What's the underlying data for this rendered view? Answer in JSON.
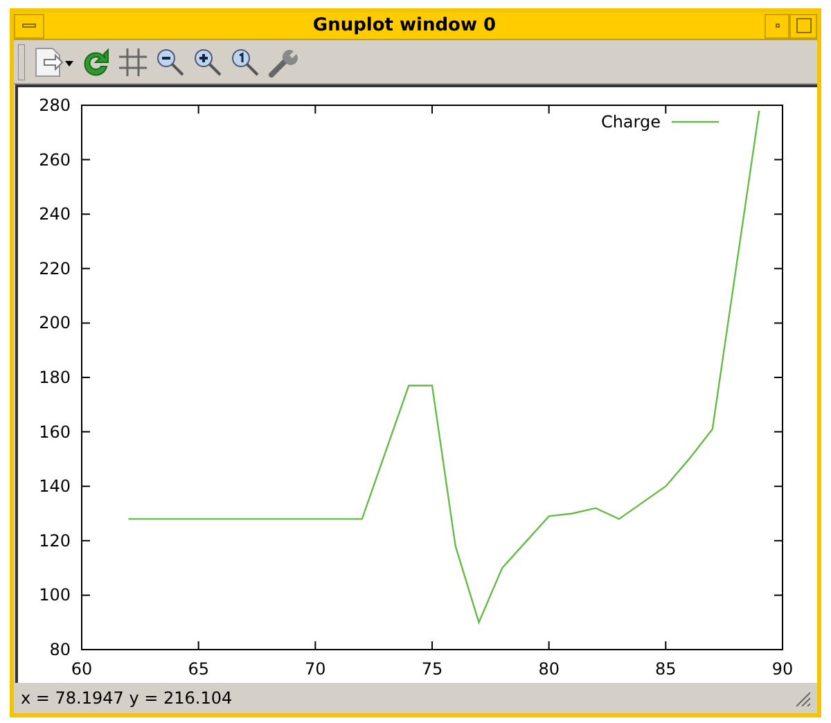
{
  "window": {
    "title": "Gnuplot window 0"
  },
  "plot": {
    "chart_data": {
      "type": "line",
      "x": [
        62,
        72,
        74,
        75,
        76,
        77,
        78,
        80,
        81,
        82,
        83,
        85,
        86,
        87,
        89
      ],
      "series": [
        {
          "name": "Charge",
          "color": "#66bb44",
          "values": [
            128,
            128,
            177,
            177,
            118,
            90,
            110,
            129,
            130,
            132,
            128,
            140,
            150,
            161,
            278
          ]
        }
      ],
      "xlim": [
        60,
        90
      ],
      "ylim": [
        80,
        280
      ],
      "xticks": [
        60,
        65,
        70,
        75,
        80,
        85,
        90
      ],
      "yticks": [
        80,
        100,
        120,
        140,
        160,
        180,
        200,
        220,
        240,
        260,
        280
      ]
    }
  },
  "status_bar": "x = 78.1947 y = 216.104"
}
